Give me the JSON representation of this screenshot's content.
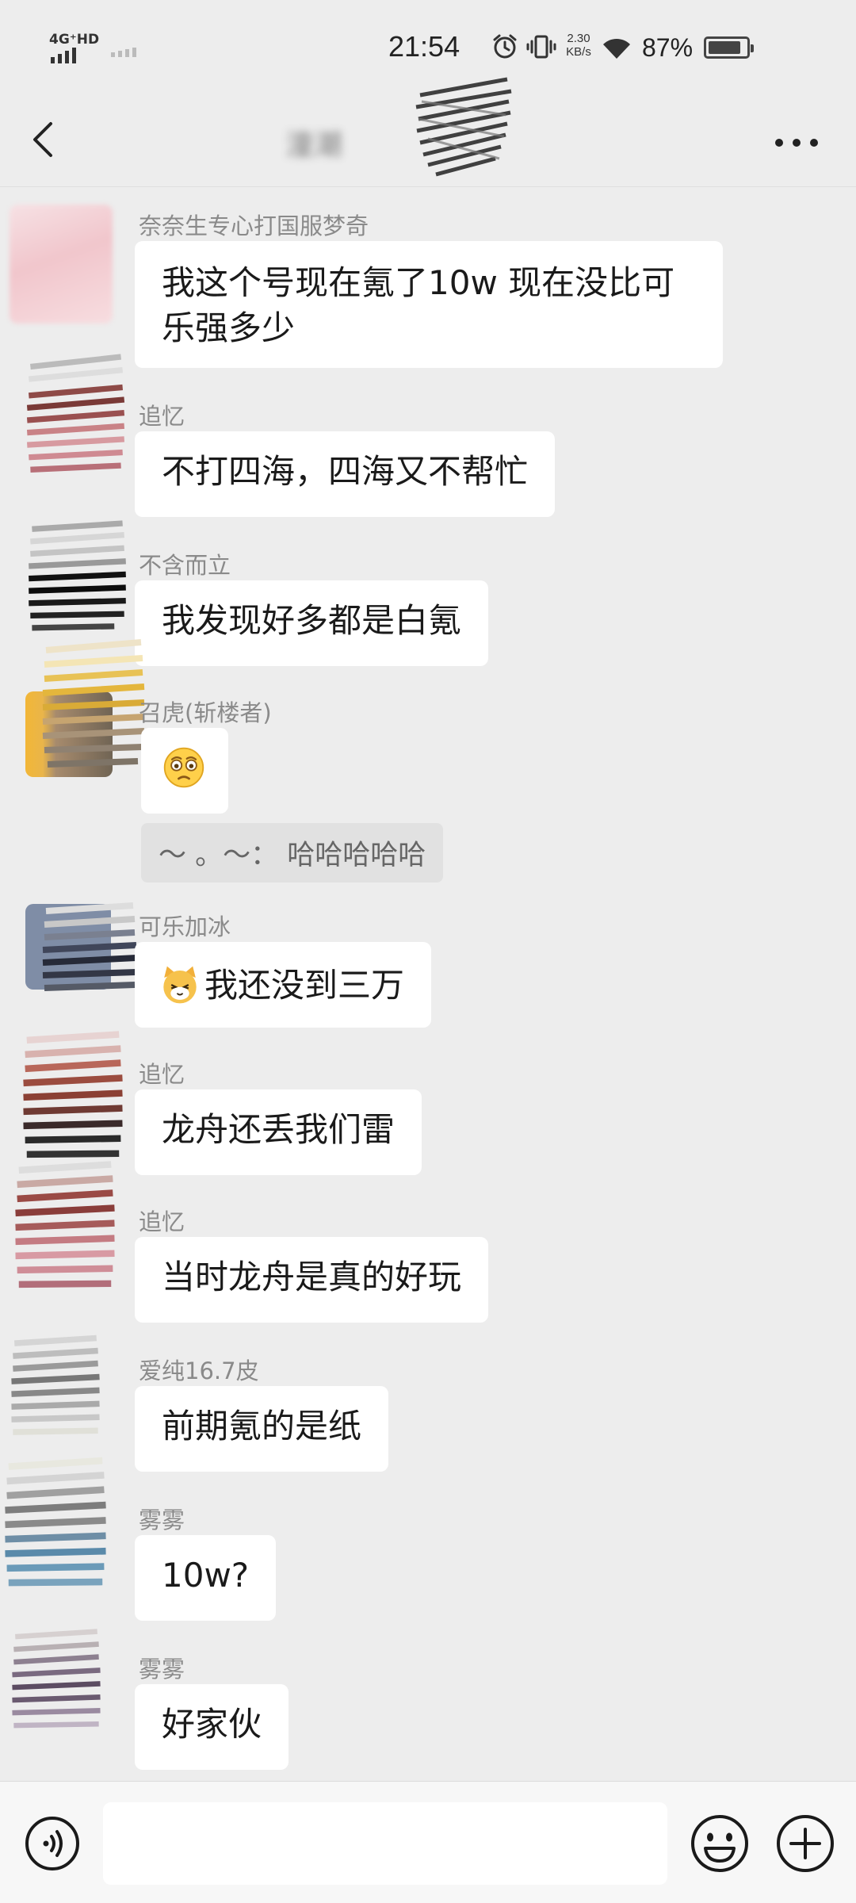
{
  "status_bar": {
    "network": "4G⁺HD",
    "time": "21:54",
    "speed_value": "2.30",
    "speed_unit": "KB/s",
    "battery_percent": "87%",
    "battery_level": 0.87
  },
  "header": {
    "title": "潼潮",
    "title_redacted": true
  },
  "messages": [
    {
      "sender": "奈奈生专心打国服梦奇",
      "text": "我这个号现在氪了10w   现在没比可乐强多少"
    },
    {
      "sender": "追忆",
      "text": "不打四海，四海又不帮忙"
    },
    {
      "sender": "不含而立",
      "text": "我发现好多都是白氪"
    },
    {
      "sender": "召虎(斩楼者)",
      "text": "🥺",
      "emoji": "pleading-face"
    },
    {
      "sender": "可乐加冰",
      "text": "我还没到三万",
      "emoji_prefix": "cat-face"
    },
    {
      "sender": "追忆",
      "text": "龙舟还丢我们雷"
    },
    {
      "sender": "追忆",
      "text": "当时龙舟是真的好玩"
    },
    {
      "sender": "爱纯16.7皮",
      "text": "前期氪的是纸"
    },
    {
      "sender": "雾雾",
      "text": "10w?"
    },
    {
      "sender": "雾雾",
      "text": "好家伙"
    }
  ],
  "system_note": "～ 。～： 哈哈哈哈哈",
  "input_bar": {
    "placeholder": ""
  },
  "colors": {
    "background": "#ededed",
    "bubble": "#ffffff",
    "sender_name": "#8a8a8a"
  }
}
